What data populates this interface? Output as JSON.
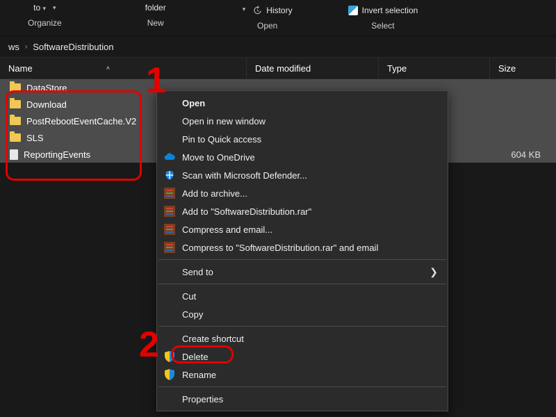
{
  "ribbon": {
    "to_label": "to",
    "folder_label": "folder",
    "history_label": "History",
    "invert_label": "Invert selection",
    "groups": {
      "organize": "Organize",
      "new": "New",
      "open": "Open",
      "select": "Select"
    }
  },
  "breadcrumb": {
    "seg1": "ws",
    "seg2": "SoftwareDistribution"
  },
  "columns": {
    "name": "Name",
    "date": "Date modified",
    "type": "Type",
    "size": "Size"
  },
  "files": [
    {
      "name": "DataStore",
      "kind": "folder",
      "size": ""
    },
    {
      "name": "Download",
      "kind": "folder",
      "size": ""
    },
    {
      "name": "PostRebootEventCache.V2",
      "kind": "folder",
      "size": ""
    },
    {
      "name": "SLS",
      "kind": "folder",
      "size": ""
    },
    {
      "name": "ReportingEvents",
      "kind": "file",
      "size": "604 KB"
    }
  ],
  "context_menu": {
    "open": "Open",
    "open_new_window": "Open in new window",
    "pin_quick_access": "Pin to Quick access",
    "move_onedrive": "Move to OneDrive",
    "scan_defender": "Scan with Microsoft Defender...",
    "add_archive": "Add to archive...",
    "add_rar": "Add to \"SoftwareDistribution.rar\"",
    "compress_email": "Compress and email...",
    "compress_rar_email": "Compress to \"SoftwareDistribution.rar\" and email",
    "send_to": "Send to",
    "cut": "Cut",
    "copy": "Copy",
    "create_shortcut": "Create shortcut",
    "delete": "Delete",
    "rename": "Rename",
    "properties": "Properties"
  },
  "annotations": {
    "one": "1",
    "two": "2"
  },
  "colors": {
    "highlight_red": "#e20000",
    "selection_bg": "#4c4c4c",
    "menu_bg": "#2b2b2b"
  }
}
